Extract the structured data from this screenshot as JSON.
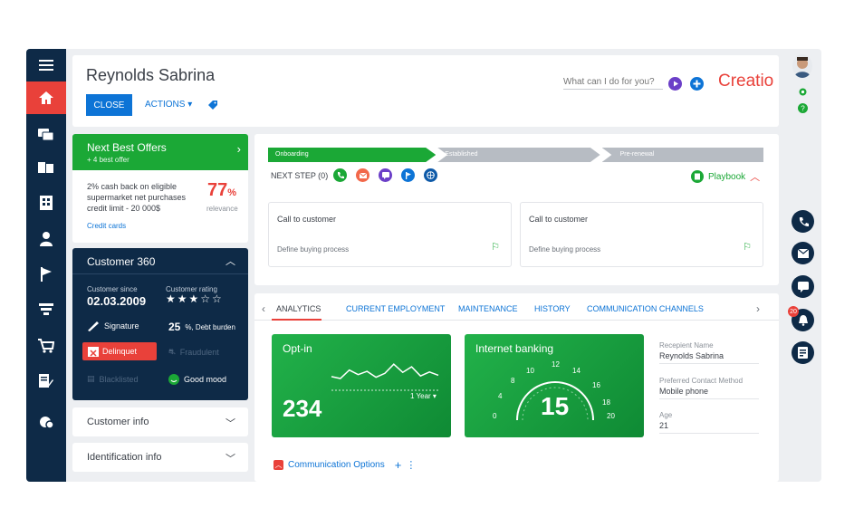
{
  "header": {
    "title": "Reynolds Sabrina",
    "close_label": "CLOSE",
    "actions_label": "ACTIONS ▾",
    "search_placeholder": "What can I do for you?",
    "logo": "Creatio"
  },
  "colors": {
    "accent_blue": "#0d74d6",
    "brand_red": "#e9413a",
    "green": "#1ba836",
    "navy": "#0e2a47"
  },
  "nav": {
    "items": [
      "menu-icon",
      "home-icon",
      "chat-icon",
      "contacts-icon",
      "accounts-icon",
      "user-icon",
      "flag-icon",
      "funnel-icon",
      "cart-icon",
      "document-edit-icon",
      "ai-insights-icon"
    ]
  },
  "offers": {
    "title": "Next Best Offers",
    "subtitle": "+ 4 best offer",
    "text": "2% cash back on eligible supermarket net purchases credit limit - 20 000$",
    "percent": "77",
    "percent_unit": "%",
    "relevance_label": "relevance",
    "link": "Credit cards"
  },
  "c360": {
    "title": "Customer 360",
    "since_label": "Customer since",
    "since_value": "02.03.2009",
    "rating_label": "Customer rating",
    "rating_stars": "★★★☆☆",
    "signature": "Signature",
    "debt_value": "25",
    "debt_label": "%, Debt burden",
    "delinquet": "Delinquet",
    "fraudulent": "Fraudulent",
    "blacklisted": "Blacklisted",
    "mood": "Good mood"
  },
  "accordion": {
    "customer_info": "Customer info",
    "identification_info": "Identification info"
  },
  "stages": [
    {
      "label": "Onboarding",
      "state": "active"
    },
    {
      "label": "Established",
      "state": "inactive"
    },
    {
      "label": "Pre-renewal",
      "state": "inactive"
    }
  ],
  "next_step": {
    "label": "NEXT STEP (0)",
    "playbook": "Playbook"
  },
  "tasks": [
    {
      "title": "Call to customer",
      "subtitle": "Define buying process"
    },
    {
      "title": "Call to customer",
      "subtitle": "Define buying process"
    }
  ],
  "tabs": [
    "ANALYTICS",
    "CURRENT EMPLOYMENT",
    "MAINTENANCE",
    "HISTORY",
    "COMMUNICATION CHANNELS"
  ],
  "optin": {
    "title": "Opt-in",
    "value": "234",
    "period": "1 Year ▾",
    "sparkline": [
      0.42,
      0.36,
      0.62,
      0.48,
      0.58,
      0.4,
      0.52,
      0.8,
      0.55,
      0.72,
      0.44,
      0.56,
      0.46
    ]
  },
  "internet_banking": {
    "title": "Internet banking",
    "value": "15",
    "ticks": [
      "0",
      "4",
      "8",
      "10",
      "12",
      "14",
      "16",
      "18",
      "20"
    ]
  },
  "fields": [
    {
      "label": "Recepient Name",
      "value": "Reynolds Sabrina"
    },
    {
      "label": "Preferred Contact Method",
      "value": "Mobile phone"
    },
    {
      "label": "Age",
      "value": "21"
    }
  ],
  "communication": {
    "label": "Communication Options"
  },
  "notifications_count": "20"
}
